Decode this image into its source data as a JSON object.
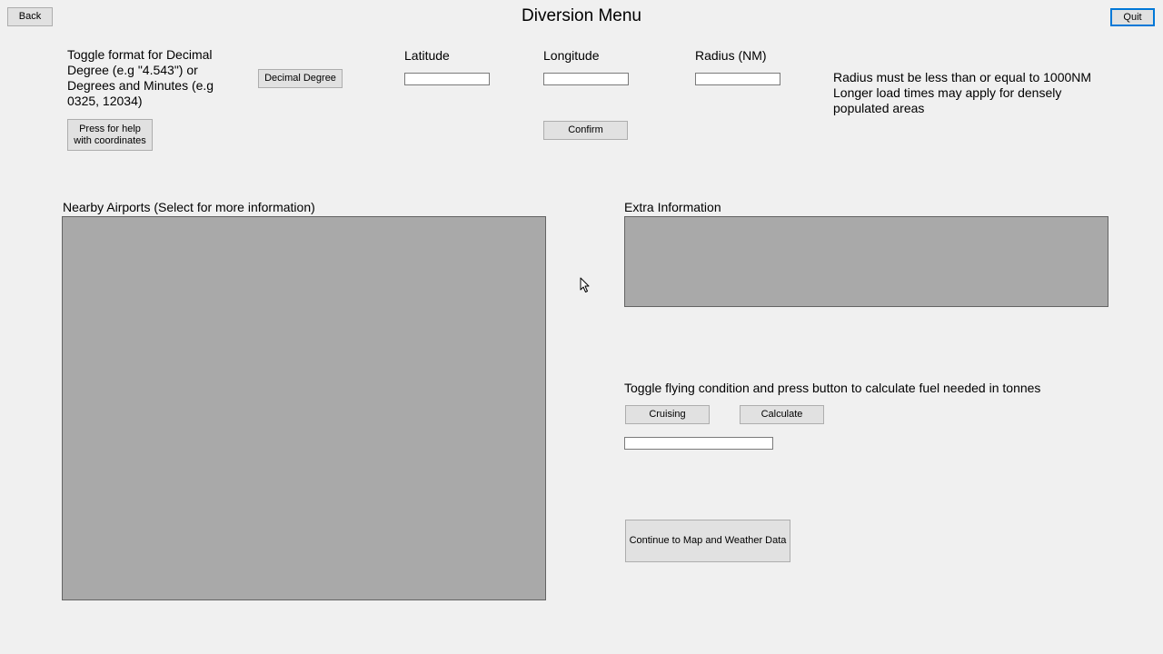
{
  "window": {
    "title": "Diversion Menu"
  },
  "header": {
    "back_label": "Back",
    "quit_label": "Quit"
  },
  "coordinates": {
    "format_help_line1": "Toggle format for Decimal",
    "format_help_line2": "Degree (e.g \"4.543\") or",
    "format_help_line3": "Degrees and Minutes (e.g",
    "format_help_line4": "0325, 12034)",
    "format_toggle_label": "Decimal Degree",
    "help_button_line1": "Press for help",
    "help_button_line2": "with coordinates",
    "latitude_label": "Latitude",
    "latitude_value": "",
    "longitude_label": "Longitude",
    "longitude_value": "",
    "radius_label": "Radius (NM)",
    "radius_value": "",
    "confirm_label": "Confirm",
    "radius_note_line1": "Radius must be less than or equal to 1000NM",
    "radius_note_line2": "Longer load times may apply for densely",
    "radius_note_line3": "populated areas"
  },
  "airports": {
    "label": "Nearby Airports (Select for more information)",
    "items": []
  },
  "extra_info": {
    "label": "Extra Information",
    "content": ""
  },
  "fuel": {
    "instructions": "Toggle flying condition and press button to calculate fuel needed in tonnes",
    "condition_label": "Cruising",
    "calculate_label": "Calculate",
    "result_value": ""
  },
  "footer": {
    "continue_label": "Continue to Map and Weather Data"
  }
}
